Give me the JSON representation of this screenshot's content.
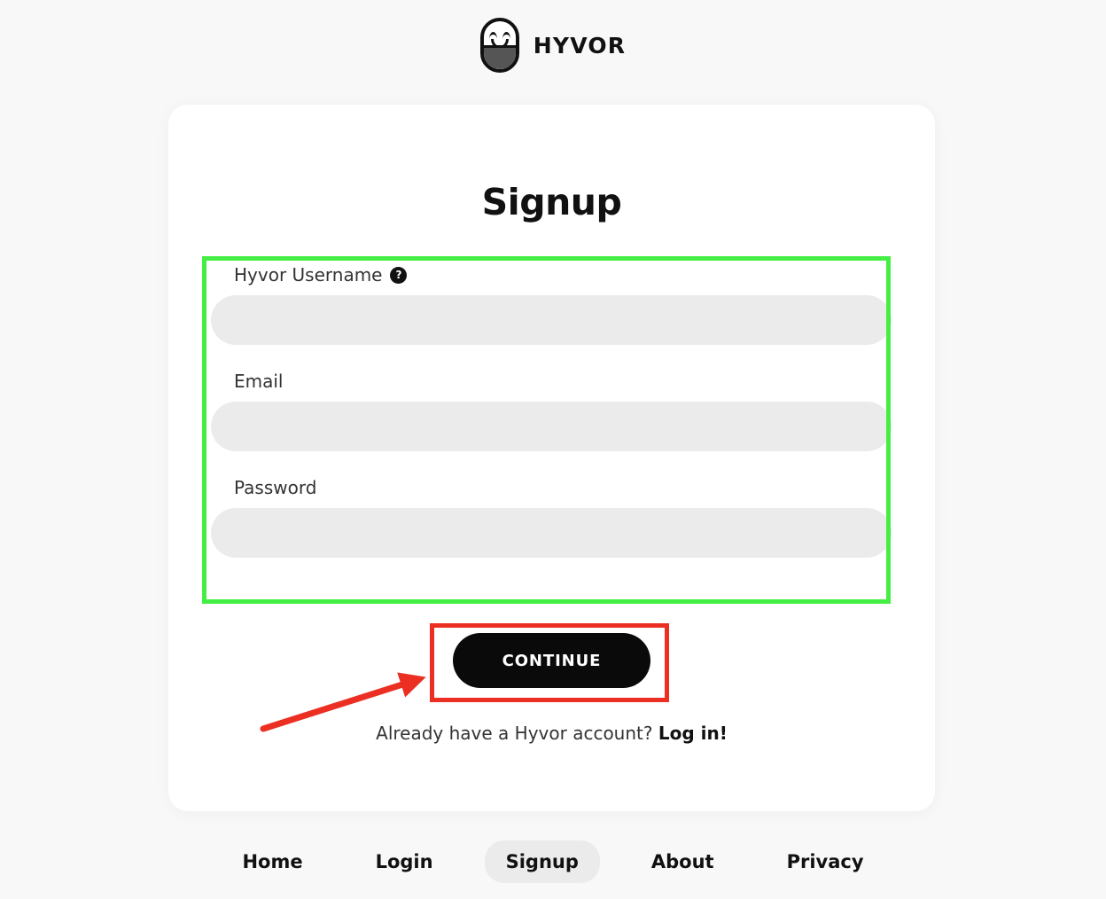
{
  "brand": {
    "name": "HYVOR",
    "logo_icon": "hyvor-capsule-smiley-logo"
  },
  "card": {
    "title": "Signup",
    "form": {
      "fields": [
        {
          "label": "Hyvor Username",
          "value": "",
          "placeholder": "",
          "help_icon": "question-mark-help-icon",
          "help_glyph": "?",
          "type": "text"
        },
        {
          "label": "Email",
          "value": "",
          "placeholder": "",
          "type": "email"
        },
        {
          "label": "Password",
          "value": "",
          "placeholder": "",
          "type": "password"
        }
      ]
    },
    "continue_label": "CONTINUE",
    "login_prompt": {
      "text": "Already have a Hyvor account?",
      "link": "Log in!"
    }
  },
  "footer_nav": {
    "items": [
      {
        "label": "Home",
        "active": false
      },
      {
        "label": "Login",
        "active": false
      },
      {
        "label": "Signup",
        "active": true
      },
      {
        "label": "About",
        "active": false
      },
      {
        "label": "Privacy",
        "active": false
      }
    ]
  },
  "annotations": {
    "green_box_color": "#44ee44",
    "red_box_color": "#ec2f23",
    "arrow_color": "#ec2f23"
  },
  "colors": {
    "page_background": "#f8f8f8",
    "card_background": "#ffffff",
    "input_background": "#ebebeb",
    "button_background": "#0a0a0a",
    "text": "#111111"
  }
}
